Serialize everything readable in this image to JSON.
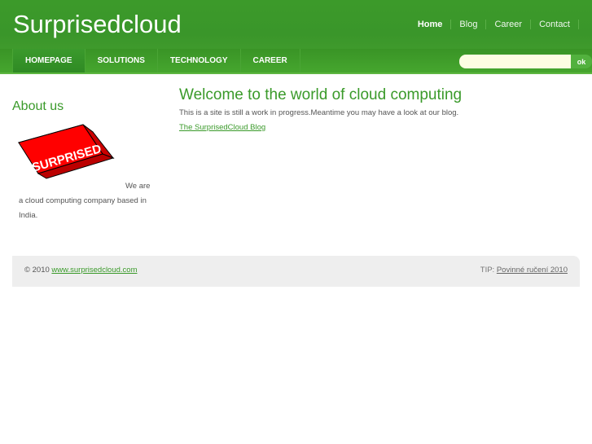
{
  "header": {
    "logo": "Surprisedcloud",
    "top_links": [
      "Home",
      "Blog",
      "Career",
      "Contact"
    ]
  },
  "nav": {
    "items": [
      "HOMEPAGE",
      "SOLUTIONS",
      "TECHNOLOGY",
      "CAREER"
    ],
    "search_value": "",
    "search_button": "ok"
  },
  "sidebar": {
    "title": "About us",
    "badge_text": "SURPRISED",
    "text": "We are a cloud computing company based in India."
  },
  "main": {
    "title": "Welcome to the world of cloud computing",
    "intro": "This is a site is still a work in progress.Meantime you may have a look at our blog.",
    "blog_link": "The SurprisedCloud Blog"
  },
  "footer": {
    "copyright": "© 2010",
    "site_link": "www.surprisedcloud.com",
    "tip_label": "TIP:",
    "tip_link": "Povinné ručení 2010"
  }
}
